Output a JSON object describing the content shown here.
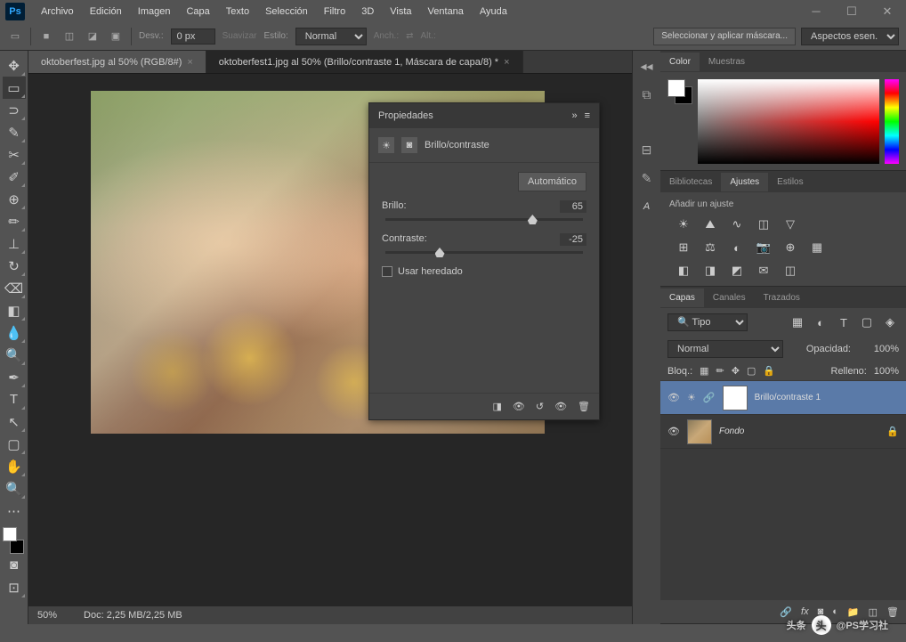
{
  "app": {
    "logo": "Ps"
  },
  "menu": [
    "Archivo",
    "Edición",
    "Imagen",
    "Capa",
    "Texto",
    "Selección",
    "Filtro",
    "3D",
    "Vista",
    "Ventana",
    "Ayuda"
  ],
  "optbar": {
    "desv_label": "Desv.:",
    "desv_val": "0 px",
    "suavizar": "Suavizar",
    "estilo": "Estilo:",
    "estilo_val": "Normal",
    "anch": "Anch.:",
    "alt": "Alt.:",
    "select_mask": "Seleccionar y aplicar máscara...",
    "aspects": "Aspectos esen."
  },
  "tabs": [
    {
      "label": "oktoberfest.jpg al 50% (RGB/8#)",
      "active": false
    },
    {
      "label": "oktoberfest1.jpg al 50% (Brillo/contraste 1, Máscara de capa/8) *",
      "active": true
    }
  ],
  "statusbar": {
    "zoom": "50%",
    "doc": "Doc: 2,25 MB/2,25 MB"
  },
  "properties": {
    "title": "Propiedades",
    "type": "Brillo/contraste",
    "auto": "Automático",
    "brillo_label": "Brillo:",
    "brillo_val": "65",
    "contraste_label": "Contraste:",
    "contraste_val": "-25",
    "legacy": "Usar heredado"
  },
  "panels": {
    "color_tabs": [
      "Color",
      "Muestras"
    ],
    "lib_tabs": [
      "Bibliotecas",
      "Ajustes",
      "Estilos"
    ],
    "adjust_label": "Añadir un ajuste",
    "layer_tabs": [
      "Capas",
      "Canales",
      "Trazados"
    ],
    "layer_filter": "Tipo",
    "blend_mode": "Normal",
    "opacity_label": "Opacidad:",
    "opacity_val": "100%",
    "lock_label": "Bloq.:",
    "fill_label": "Relleno:",
    "fill_val": "100%",
    "layers": [
      {
        "name": "Brillo/contraste 1",
        "type": "adjustment"
      },
      {
        "name": "Fondo",
        "type": "image"
      }
    ]
  },
  "watermark": {
    "prefix": "头条",
    "text": "@PS学习社"
  }
}
